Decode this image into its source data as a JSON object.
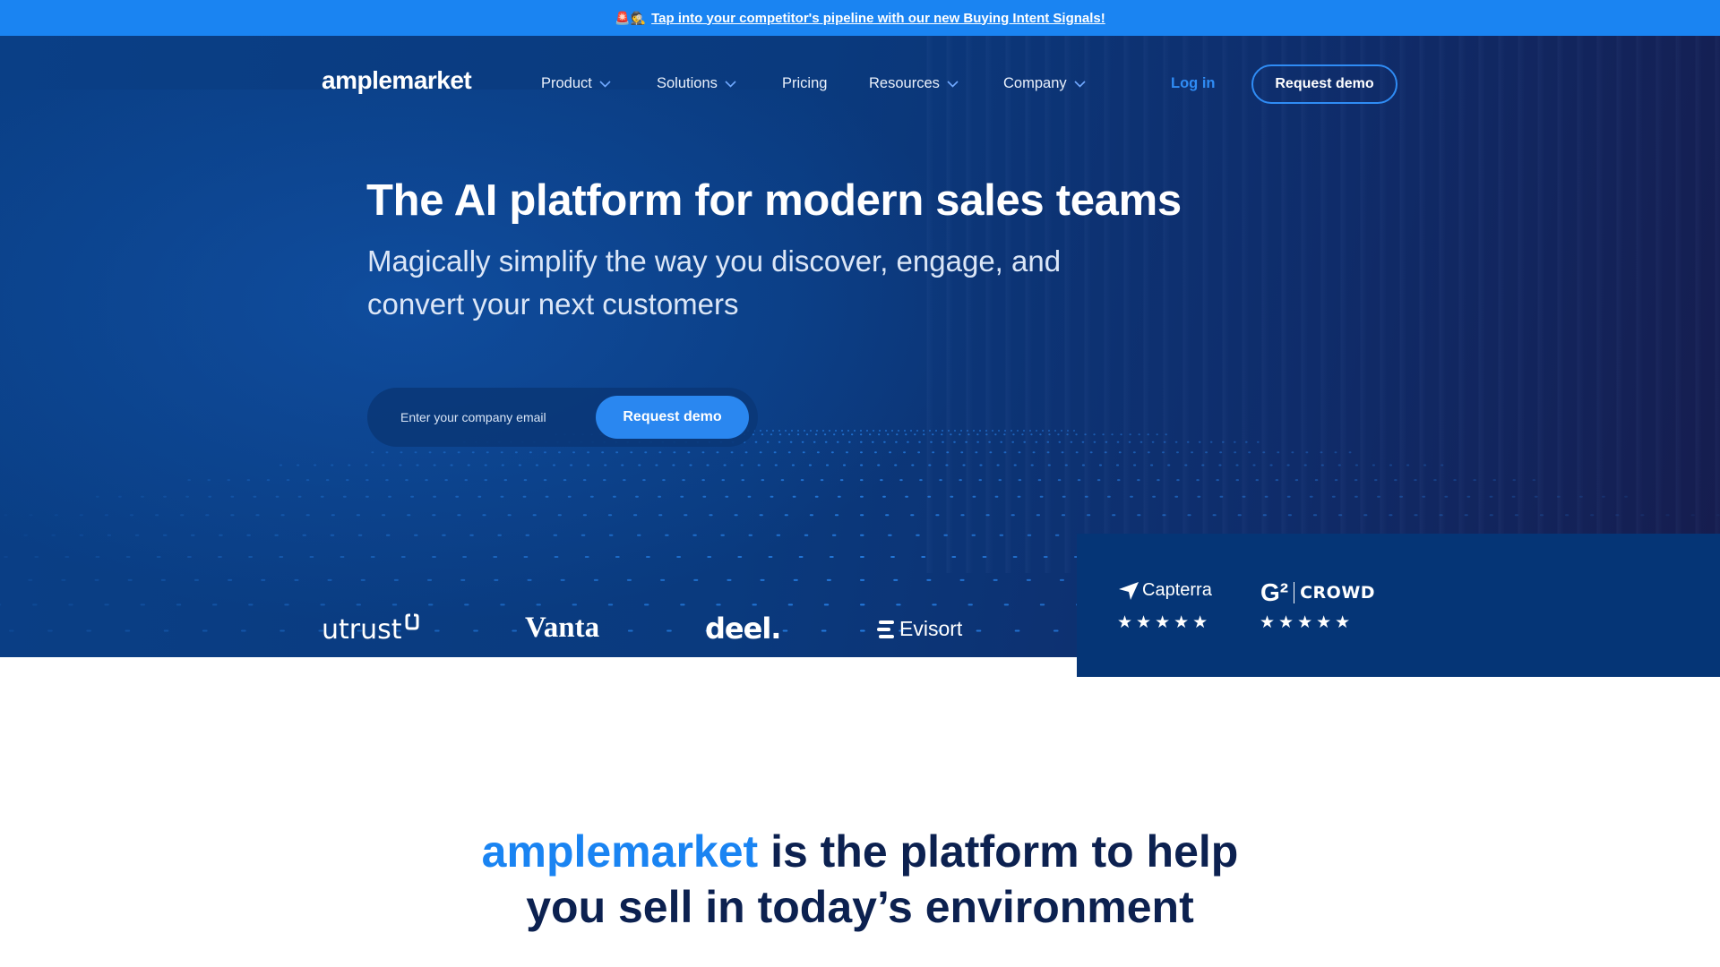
{
  "announcement": {
    "emoji": "🚨🕵",
    "text": "Tap into your competitor's pipeline with our new Buying Intent Signals!"
  },
  "nav": {
    "logo": "amplemarket",
    "items": [
      {
        "label": "Product",
        "dropdown": true
      },
      {
        "label": "Solutions",
        "dropdown": true
      },
      {
        "label": "Pricing",
        "dropdown": false
      },
      {
        "label": "Resources",
        "dropdown": true
      },
      {
        "label": "Company",
        "dropdown": true
      }
    ],
    "login": "Log in",
    "request_demo": "Request demo"
  },
  "hero": {
    "title": "The AI platform for modern sales teams",
    "subtitle": "Magically simplify the way you discover, engage, and convert your next customers",
    "email_placeholder": "Enter your company email",
    "submit_label": "Request demo"
  },
  "customers": [
    "utrust",
    "Vanta",
    "deel.",
    "Evisort"
  ],
  "reviews": {
    "capterra": {
      "name": "Capterra",
      "rating": 5,
      "stars": "★★★★★"
    },
    "g2": {
      "mark": "G²",
      "name": "CROWD",
      "rating": 5,
      "stars": "★★★★★"
    }
  },
  "section": {
    "brand": "amplemarket",
    "line1_rest": " is the platform to help",
    "line2": "you sell in today’s environment"
  },
  "colors": {
    "accent": "#1a84f2",
    "hero_bg": "#0a3f86",
    "panel_bg": "#053576",
    "heading_dark": "#0c2150"
  }
}
